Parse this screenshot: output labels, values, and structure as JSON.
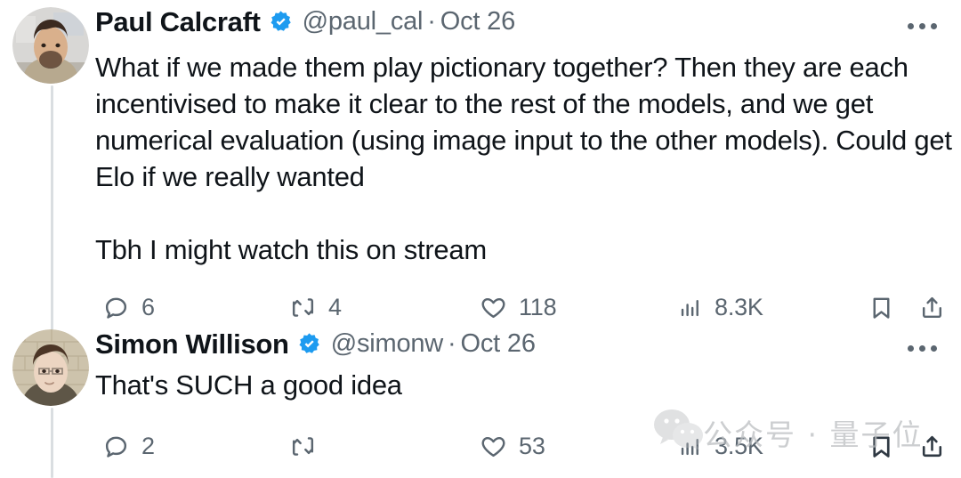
{
  "platform": "twitter-thread",
  "thread": {
    "tweets": [
      {
        "author": {
          "display_name": "Paul Calcraft",
          "handle": "@paul_cal",
          "verified": true,
          "verified_badge_color": "#1d9bf0"
        },
        "timestamp": "Oct 26",
        "separator": "·",
        "text": "What if we made them play pictionary together? Then they are each incentivised to make it clear to the rest of the models, and we get numerical evaluation (using image input to the other models). Could get Elo if we really wanted\n\nTbh I might watch this on stream",
        "actions": {
          "reply": {
            "icon": "reply-icon",
            "count": "6"
          },
          "repost": {
            "icon": "repost-icon",
            "count": "4"
          },
          "like": {
            "icon": "heart-icon",
            "count": "118"
          },
          "views": {
            "icon": "views-icon",
            "count": "8.3K"
          },
          "bookmark": {
            "icon": "bookmark-icon",
            "count": ""
          },
          "share": {
            "icon": "share-icon",
            "count": ""
          }
        },
        "more_menu": "more-options-icon"
      },
      {
        "author": {
          "display_name": "Simon Willison",
          "handle": "@simonw",
          "verified": true,
          "verified_badge_color": "#1d9bf0"
        },
        "timestamp": "Oct 26",
        "separator": "·",
        "text": "That's SUCH a good idea",
        "actions": {
          "reply": {
            "icon": "reply-icon",
            "count": "2"
          },
          "repost": {
            "icon": "repost-icon",
            "count": ""
          },
          "like": {
            "icon": "heart-icon",
            "count": "53"
          },
          "views": {
            "icon": "views-icon",
            "count": "3.5K"
          },
          "bookmark": {
            "icon": "bookmark-icon",
            "count": ""
          },
          "share": {
            "icon": "share-icon",
            "count": ""
          }
        },
        "more_menu": "more-options-icon"
      }
    ]
  },
  "watermark": {
    "logo": "wechat-logo-icon",
    "text": "公众号 · 量子位",
    "color": "#b9bcbf"
  },
  "colors": {
    "text_primary": "#0f1419",
    "text_secondary": "#5b6670",
    "verified_blue": "#1d9bf0",
    "thread_line": "#dadee1",
    "background": "#ffffff"
  }
}
